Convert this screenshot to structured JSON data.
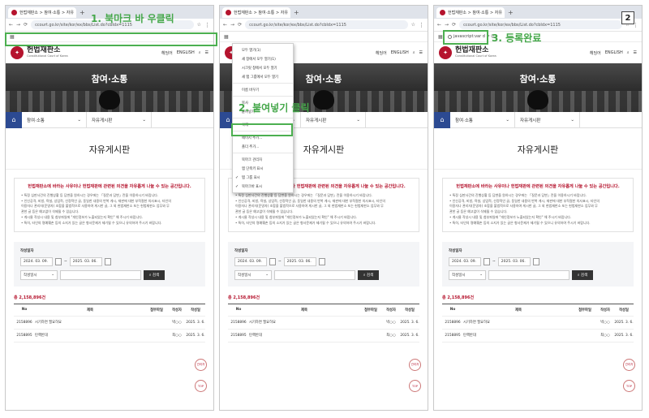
{
  "step_number": "2",
  "colors": {
    "accent_green": "#4caf50",
    "brand_red": "#b5142e",
    "home_blue": "#2c4a92"
  },
  "browser": {
    "tab_title": "헌법재판소 > 참여·소통 > 자유",
    "new_tab": "+",
    "url": "ccourt.go.kr/site/kor/ex/bbs/List.do?cbIdx=1115",
    "new_bookmark_label": "javascript:var d = (j..."
  },
  "site": {
    "logo_ko": "헌법재판소",
    "logo_en": "Constitutional Court of Korea",
    "lang_links": [
      "헤딩어",
      "ENGLISH"
    ],
    "hero_title": "참여·소통",
    "crumb_1": "참여·소통",
    "crumb_2": "자유게시판",
    "page_title": "자유게시판",
    "notice_title": "헌법재판소에 바라는 사유이나 헌법재판에 관련된 의견을 자유롭게 나눌 수 있는 공간입니다.",
    "notice_lines": [
      "• 특정 심판사건의 진행상황 등 답변을 원하시는 경우에는 「질문과 답변」란을 이용하시기 바랍니다.",
      "• 인신공격, 비방, 욕설, 상업적, 선정적인 글, 동일한 내용의 반복 게시, 재판에 대한 부적절한 의사표시, 타인의",
      "  이용자나 관리자(운영자) 조합을 불법적으로 사용하여 게시한 글, 그 외 헌법재판소 또는 헌법재판소 업무와 무",
      "  관한 글 등은 예고없이 삭제될 수 있습니다.",
      "• 게시물 작성시 내용 및 첨부파일에 \"개인정보가 노출되었는지 확인\" 해 주시기 바랍니다.",
      "• 특히, 타인의 명예훼손 등의 소지가 있는 글은 형사문제가 제기될 수 있으니 유의하여 주시기 바랍니다."
    ],
    "search_label": "작성일자",
    "date_from": "2024. 03. 09.",
    "date_to": "2025. 03. 06.",
    "date_sep": "~",
    "select_value": "작성일시",
    "search_button": "검색",
    "total_count": "총 2,158,896건",
    "table_headers": [
      "No",
      "제목",
      "첨부파일",
      "작성자",
      "작성일"
    ],
    "rows": [
      {
        "no": "2158896",
        "title": "시기하면 필요하요",
        "attach": "",
        "author": "박○○",
        "date": "2025. 3. 6."
      },
      {
        "no": "2158895",
        "title": "탄핵반대",
        "attach": "",
        "author": "최○○",
        "date": "2025. 3. 6."
      }
    ],
    "fab_1": "관리자",
    "fab_2": "TOP"
  },
  "context_menu": {
    "items": [
      "모두 열기(1)",
      "새 창에서 모두 열기(1)",
      "시크릿 창에서 모두 열기",
      "새 탭 그룹에서 모두 열기",
      "이름 바꾸기",
      "복사",
      "붙여넣기",
      "삭제",
      "페이지 추가...",
      "폴더 추가...",
      "북마크 관리자",
      "앱 단축키 표시",
      "탭 그룹 표시",
      "북마크바 표시"
    ],
    "paste_label": "붙여넣기"
  },
  "callouts": {
    "step1": "1. 북마크 바 우클릭",
    "step2": "2. 붙여넣기 클릭",
    "step3": "3. 등록완료"
  }
}
